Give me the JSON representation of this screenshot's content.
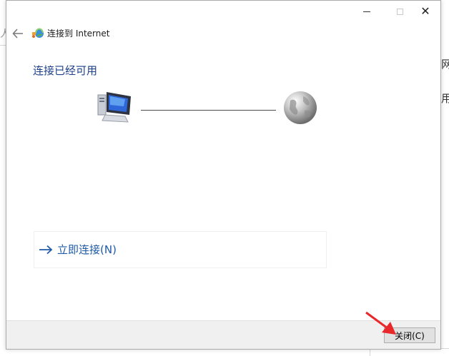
{
  "background": {
    "left_glyph": "人",
    "right_glyphs": [
      "网",
      "用"
    ]
  },
  "window": {
    "controls": {
      "minimize_icon": "minimize-icon",
      "maximize_icon": "maximize-icon",
      "close_icon": "close-icon",
      "close_glyph": "✕"
    },
    "header": {
      "title": "连接到 Internet",
      "back_icon": "back-arrow-icon",
      "network_icon": "network-globe-icon"
    },
    "status_heading": "连接已经可用",
    "diagram": {
      "computer_icon": "computer-icon",
      "globe_icon": "internet-globe-icon"
    },
    "connect_now": {
      "label": "立即连接(N)",
      "icon": "right-arrow-icon"
    },
    "footer": {
      "close_button_label": "关闭(C)"
    }
  },
  "annotation": {
    "pointer_icon": "red-pointer-arrow-icon",
    "color": "#e8282b"
  },
  "colors": {
    "heading": "#1e3f8a",
    "link": "#1e5aa8",
    "footer_bg": "#f0f0f0"
  }
}
